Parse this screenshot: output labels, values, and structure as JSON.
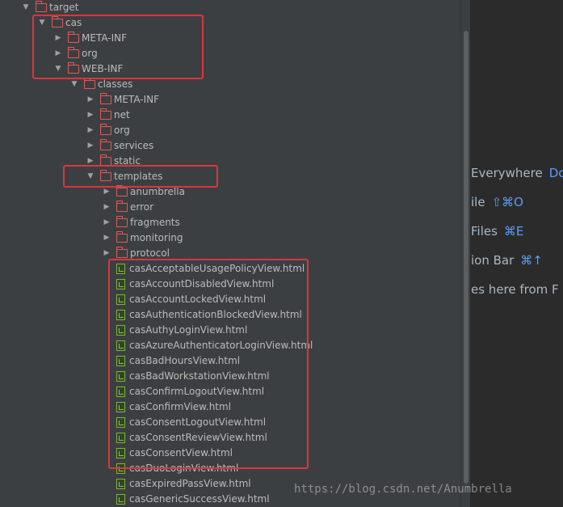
{
  "tree": [
    {
      "label": "target",
      "type": "folder",
      "expanded": true,
      "depth": 0
    },
    {
      "label": "cas",
      "type": "folder",
      "expanded": true,
      "depth": 1
    },
    {
      "label": "META-INF",
      "type": "folder",
      "expanded": false,
      "depth": 2
    },
    {
      "label": "org",
      "type": "folder",
      "expanded": false,
      "depth": 2
    },
    {
      "label": "WEB-INF",
      "type": "folder",
      "expanded": true,
      "depth": 2
    },
    {
      "label": "classes",
      "type": "folder",
      "expanded": true,
      "depth": 3
    },
    {
      "label": "META-INF",
      "type": "folder",
      "expanded": false,
      "depth": 4
    },
    {
      "label": "net",
      "type": "folder",
      "expanded": false,
      "depth": 4
    },
    {
      "label": "org",
      "type": "folder",
      "expanded": false,
      "depth": 4
    },
    {
      "label": "services",
      "type": "folder",
      "expanded": false,
      "depth": 4
    },
    {
      "label": "static",
      "type": "folder",
      "expanded": false,
      "depth": 4
    },
    {
      "label": "templates",
      "type": "folder",
      "expanded": true,
      "depth": 4
    },
    {
      "label": "anumbrella",
      "type": "folder",
      "expanded": false,
      "depth": 5
    },
    {
      "label": "error",
      "type": "folder",
      "expanded": false,
      "depth": 5
    },
    {
      "label": "fragments",
      "type": "folder",
      "expanded": false,
      "depth": 5
    },
    {
      "label": "monitoring",
      "type": "folder",
      "expanded": false,
      "depth": 5
    },
    {
      "label": "protocol",
      "type": "folder",
      "expanded": false,
      "depth": 5
    },
    {
      "label": "casAcceptableUsagePolicyView.html",
      "type": "file",
      "depth": 5
    },
    {
      "label": "casAccountDisabledView.html",
      "type": "file",
      "depth": 5
    },
    {
      "label": "casAccountLockedView.html",
      "type": "file",
      "depth": 5
    },
    {
      "label": "casAuthenticationBlockedView.html",
      "type": "file",
      "depth": 5
    },
    {
      "label": "casAuthyLoginView.html",
      "type": "file",
      "depth": 5
    },
    {
      "label": "casAzureAuthenticatorLoginView.html",
      "type": "file",
      "depth": 5
    },
    {
      "label": "casBadHoursView.html",
      "type": "file",
      "depth": 5
    },
    {
      "label": "casBadWorkstationView.html",
      "type": "file",
      "depth": 5
    },
    {
      "label": "casConfirmLogoutView.html",
      "type": "file",
      "depth": 5
    },
    {
      "label": "casConfirmView.html",
      "type": "file",
      "depth": 5
    },
    {
      "label": "casConsentLogoutView.html",
      "type": "file",
      "depth": 5
    },
    {
      "label": "casConsentReviewView.html",
      "type": "file",
      "depth": 5
    },
    {
      "label": "casConsentView.html",
      "type": "file",
      "depth": 5
    },
    {
      "label": "casDuoLoginView.html",
      "type": "file",
      "depth": 5
    },
    {
      "label": "casExpiredPassView.html",
      "type": "file",
      "depth": 5
    },
    {
      "label": "casGenericSuccessView.html",
      "type": "file",
      "depth": 5
    }
  ],
  "hints": [
    {
      "text": "Everywhere",
      "key": "Do"
    },
    {
      "text": "ile",
      "key": "⇧⌘O"
    },
    {
      "text": "Files",
      "key": "⌘E"
    },
    {
      "text": "ion Bar",
      "key": "⌘↑"
    },
    {
      "text": "es here from F",
      "key": ""
    }
  ],
  "watermark": "https://blog.csdn.net/Anumbrella",
  "colors": {
    "highlight": "#d9363e",
    "folder_icon": "#e05a5a",
    "html_icon": "#7cb342",
    "shortcut": "#589df6"
  }
}
